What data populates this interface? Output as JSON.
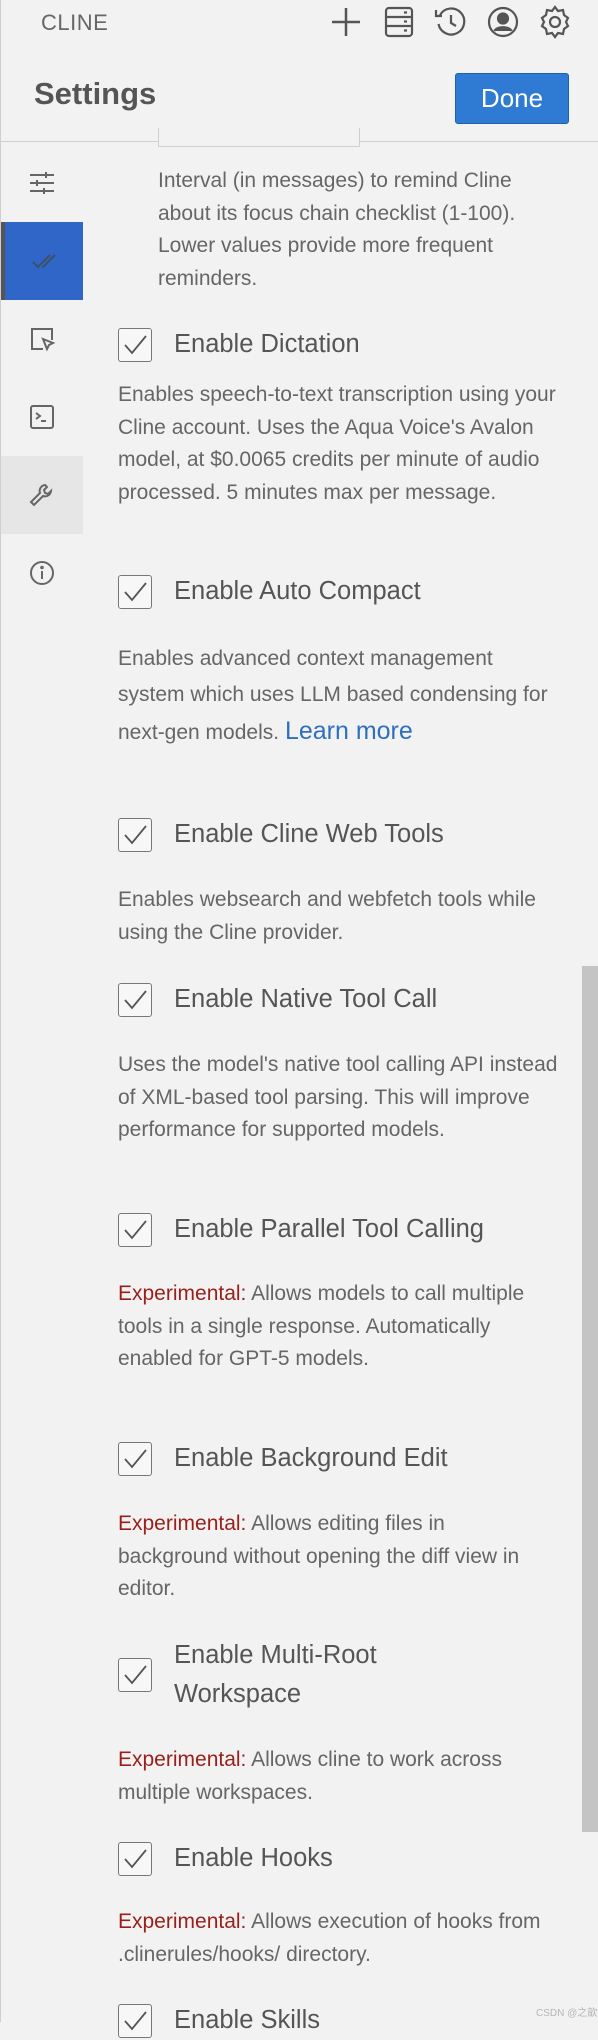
{
  "app": {
    "name": "CLINE"
  },
  "toolbar_icons": [
    "plus-icon",
    "server-icon",
    "history-icon",
    "account-icon",
    "gear-icon"
  ],
  "header": {
    "title": "Settings",
    "done_label": "Done"
  },
  "sidebar": {
    "items": [
      {
        "icon": "sliders-icon",
        "state": "normal"
      },
      {
        "icon": "checks-icon",
        "state": "active"
      },
      {
        "icon": "browser-cursor-icon",
        "state": "normal"
      },
      {
        "icon": "terminal-icon",
        "state": "normal"
      },
      {
        "icon": "wrench-icon",
        "state": "hover"
      },
      {
        "icon": "info-icon",
        "state": "normal"
      }
    ]
  },
  "focus_chain": {
    "description": "Interval (in messages) to remind Cline about its focus chain checklist (1-100). Lower values provide more frequent reminders."
  },
  "settings": [
    {
      "label": "Enable Dictation",
      "checked": true,
      "description": "Enables speech-to-text transcription using your Cline account. Uses the Aqua Voice's Avalon model, at $0.0065 credits per minute of audio processed. 5 minutes max per message."
    },
    {
      "label": "Enable Auto Compact",
      "checked": true,
      "description": "Enables advanced context management system which uses LLM based condensing for next-gen models.",
      "link": "Learn more"
    },
    {
      "label": "Enable Cline Web Tools",
      "checked": true,
      "description": "Enables websearch and webfetch tools while using the Cline provider."
    },
    {
      "label": "Enable Native Tool Call",
      "checked": true,
      "description": "Uses the model's native tool calling API instead of XML-based tool parsing. This will improve performance for supported models."
    },
    {
      "label": "Enable Parallel Tool Calling",
      "checked": true,
      "prefix": "Experimental:",
      "description": " Allows models to call multiple tools in a single response. Automatically enabled for GPT-5 models."
    },
    {
      "label": "Enable Background Edit",
      "checked": true,
      "prefix": "Experimental:",
      "description": " Allows editing files in background without opening the diff view in editor."
    },
    {
      "label": "Enable Multi-Root Workspace",
      "checked": true,
      "prefix": "Experimental:",
      "description": " Allows cline to work across multiple workspaces."
    },
    {
      "label": "Enable Hooks",
      "checked": true,
      "prefix": "Experimental:",
      "description": " Allows execution of hooks from .clinerules/hooks/ directory."
    },
    {
      "label": "Enable Skills",
      "checked": true
    }
  ],
  "watermark": "CSDN @之歆",
  "colors": {
    "accent": "#2f7ad2",
    "experimental": "#9a1f1a",
    "link": "#2f6fc0"
  }
}
